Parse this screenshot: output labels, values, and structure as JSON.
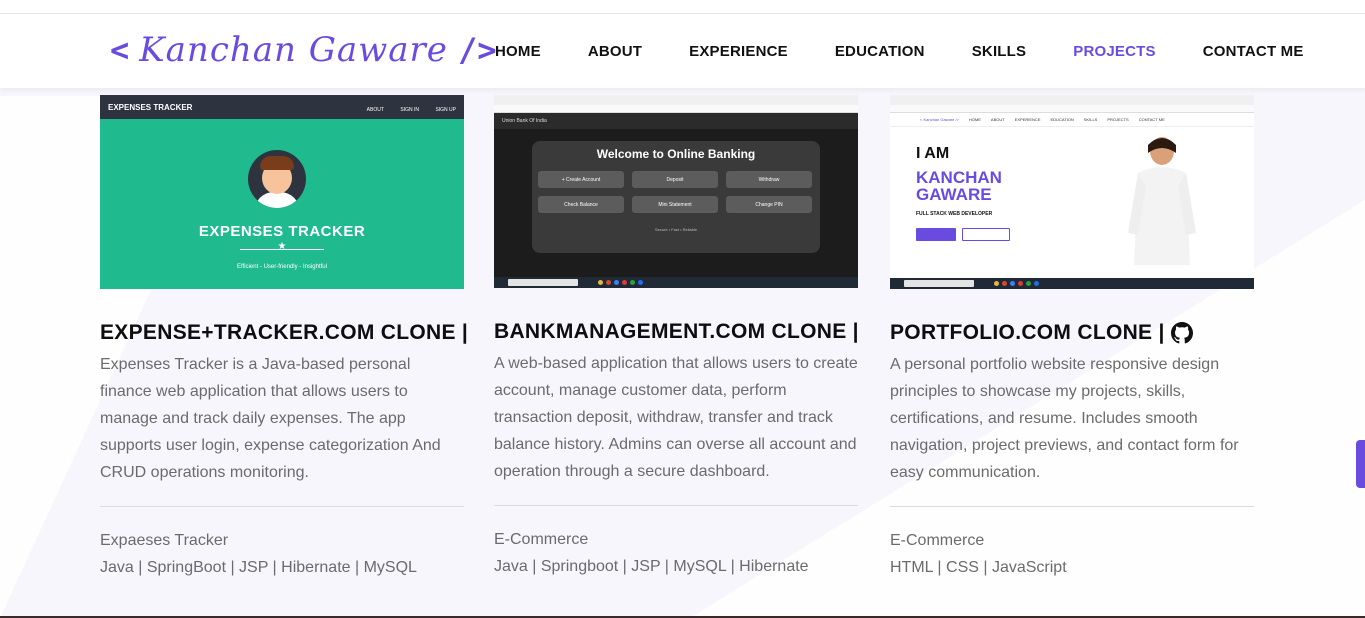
{
  "header": {
    "logo_text": "Kanchan Gaware",
    "logo_open": "<",
    "logo_close": "/>",
    "nav": [
      {
        "label": "HOME"
      },
      {
        "label": "ABOUT"
      },
      {
        "label": "EXPERIENCE"
      },
      {
        "label": "EDUCATION"
      },
      {
        "label": "SKILLS"
      },
      {
        "label": "PROJECTS",
        "active": true
      },
      {
        "label": "CONTACT ME"
      }
    ]
  },
  "projects": [
    {
      "title": "EXPENSE+TRACKER.COM CLONE |",
      "description": "Expenses Tracker is a Java-based personal finance web application that allows users to manage and track daily expenses. The app supports user login, expense categorization And CRUD operations monitoring.",
      "category": "Expaeses Tracker",
      "tech": "Java | SpringBoot | JSP | Hibernate | MySQL",
      "thumb": {
        "brand": "EXPENSES TRACKER",
        "links": [
          "ABOUT",
          "SIGN IN",
          "SIGN UP"
        ],
        "headline": "EXPENSES TRACKER",
        "tagline": "Efficient - User-friendly - Insightful"
      }
    },
    {
      "title": "BANKMANAGEMENT.COM CLONE |",
      "description": "A web-based application that allows users to create account, manage customer data, perform transaction deposit, withdraw, transfer and track balance history. Admins can overse all account and operation through a secure dashboard.",
      "category": "E-Commerce",
      "tech": "Java | Springboot | JSP | MySQL | Hibernate",
      "thumb": {
        "appbar": "Union Bank Of India",
        "headline": "Welcome to Online Banking",
        "buttons": [
          "+ Create Account",
          "Deposit",
          "Withdraw",
          "Check Balance",
          "Mini Statement",
          "Change PIN"
        ],
        "footer": "Secure • Fast • Reliable"
      }
    },
    {
      "title": "PORTFOLIO.COM CLONE |",
      "description": "A personal portfolio website responsive design principles to showcase my projects, skills, certifications, and resume. Includes smooth navigation, project previews, and contact form for easy communication.",
      "category": "E-Commerce",
      "tech": "HTML | CSS | JavaScript",
      "thumb": {
        "logo": "< Kanchan Gaware />",
        "nav": [
          "HOME",
          "ABOUT",
          "EXPERIENCE",
          "EDUCATION",
          "SKILLS",
          "PROJECTS",
          "CONTACT ME"
        ],
        "line1": "I AM",
        "line2": "KANCHAN",
        "line3": "GAWARE",
        "role": "FULL STACK WEB DEVELOPER"
      }
    }
  ],
  "colors": {
    "accent": "#6a4be0",
    "text_muted": "#6b6b6b",
    "card_green": "#1fba8e"
  }
}
